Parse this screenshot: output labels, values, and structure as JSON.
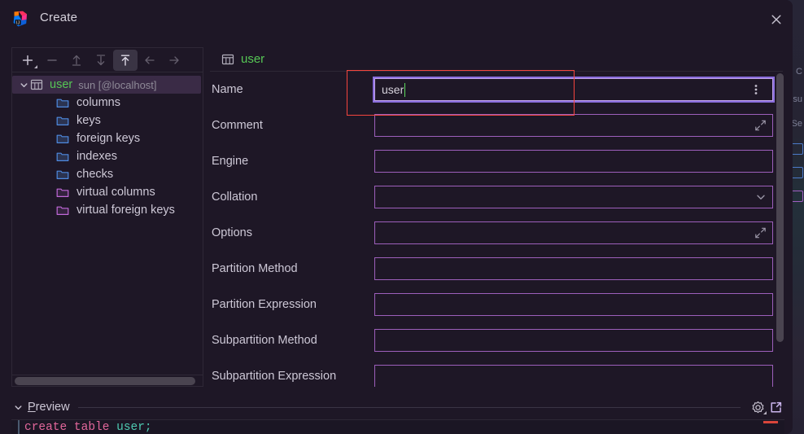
{
  "window": {
    "title": "Create",
    "app_icon": "intellij-idea-logo",
    "close_icon": "close-icon",
    "bg_color": "#1e1726",
    "accent_border": "#9d5fbb",
    "focus_ring": "#8b6ede",
    "annotation_color": "#f4453d",
    "green_text": "#56c755"
  },
  "tree_toolbar": {
    "buttons": [
      {
        "name": "add-button",
        "icon": "plus-icon",
        "label": "Add",
        "state": "enabled",
        "has_dropdown": true
      },
      {
        "name": "remove-button",
        "icon": "minus-icon",
        "label": "Remove",
        "state": "disabled",
        "has_dropdown": false
      },
      {
        "name": "move-up-button",
        "icon": "arrow-up-to-line-icon",
        "label": "Move Up",
        "state": "disabled",
        "has_dropdown": false
      },
      {
        "name": "move-down-button",
        "icon": "arrow-down-to-line-icon",
        "label": "Move Down",
        "state": "disabled",
        "has_dropdown": false
      },
      {
        "name": "move-to-top-button",
        "icon": "arrow-up-to-top-icon",
        "label": "Move To Top",
        "state": "selected",
        "has_dropdown": false
      },
      {
        "name": "back-button",
        "icon": "arrow-left-icon",
        "label": "Back",
        "state": "disabled",
        "has_dropdown": false
      },
      {
        "name": "forward-button",
        "icon": "arrow-right-icon",
        "label": "Forward",
        "state": "disabled",
        "has_dropdown": false
      }
    ]
  },
  "tree": {
    "root": {
      "name": "user",
      "subtitle": "sun [@localhost]",
      "icon": "table-icon",
      "expanded": true,
      "selected": true
    },
    "children": [
      {
        "label": "columns",
        "icon": "folder-icon",
        "color": "blue"
      },
      {
        "label": "keys",
        "icon": "folder-icon",
        "color": "blue"
      },
      {
        "label": "foreign keys",
        "icon": "folder-icon",
        "color": "blue"
      },
      {
        "label": "indexes",
        "icon": "folder-icon",
        "color": "blue"
      },
      {
        "label": "checks",
        "icon": "folder-icon",
        "color": "blue"
      },
      {
        "label": "virtual columns",
        "icon": "folder-icon",
        "color": "purple"
      },
      {
        "label": "virtual foreign keys",
        "icon": "folder-icon",
        "color": "purple"
      }
    ]
  },
  "form": {
    "header": {
      "icon": "table-icon",
      "name": "user"
    },
    "rows": [
      {
        "label": "Name",
        "value": "user",
        "placeholder": "",
        "control": "text",
        "focused": true,
        "trailing_icon": "",
        "more_icon": "more-vertical-icon"
      },
      {
        "label": "Comment",
        "value": "",
        "placeholder": "",
        "control": "text",
        "focused": false,
        "trailing_icon": "expand-icon",
        "more_icon": ""
      },
      {
        "label": "Engine",
        "value": "",
        "placeholder": "",
        "control": "text",
        "focused": false,
        "trailing_icon": "",
        "more_icon": ""
      },
      {
        "label": "Collation",
        "value": "",
        "placeholder": "",
        "control": "combo",
        "focused": false,
        "trailing_icon": "chevron-down-icon",
        "more_icon": ""
      },
      {
        "label": "Options",
        "value": "",
        "placeholder": "",
        "control": "text",
        "focused": false,
        "trailing_icon": "expand-icon",
        "more_icon": ""
      },
      {
        "label": "Partition Method",
        "value": "",
        "placeholder": "",
        "control": "text",
        "focused": false,
        "trailing_icon": "",
        "more_icon": ""
      },
      {
        "label": "Partition Expression",
        "value": "",
        "placeholder": "",
        "control": "text",
        "focused": false,
        "trailing_icon": "",
        "more_icon": ""
      },
      {
        "label": "Subpartition Method",
        "value": "",
        "placeholder": "",
        "control": "text",
        "focused": false,
        "trailing_icon": "",
        "more_icon": ""
      },
      {
        "label": "Subpartition Expression",
        "value": "",
        "placeholder": "",
        "control": "text",
        "focused": false,
        "trailing_icon": "",
        "more_icon": ""
      }
    ]
  },
  "preview": {
    "label_prefix": "P",
    "label_rest": "review",
    "expanded": true,
    "chevron_icon": "chevron-down-icon",
    "settings_icon": "gear-icon",
    "popout_icon": "open-in-new-window-icon",
    "code_keyword": "create table ",
    "code_identifier": "user;"
  },
  "background": {
    "fragments": [
      "C",
      "su",
      "Se"
    ]
  }
}
